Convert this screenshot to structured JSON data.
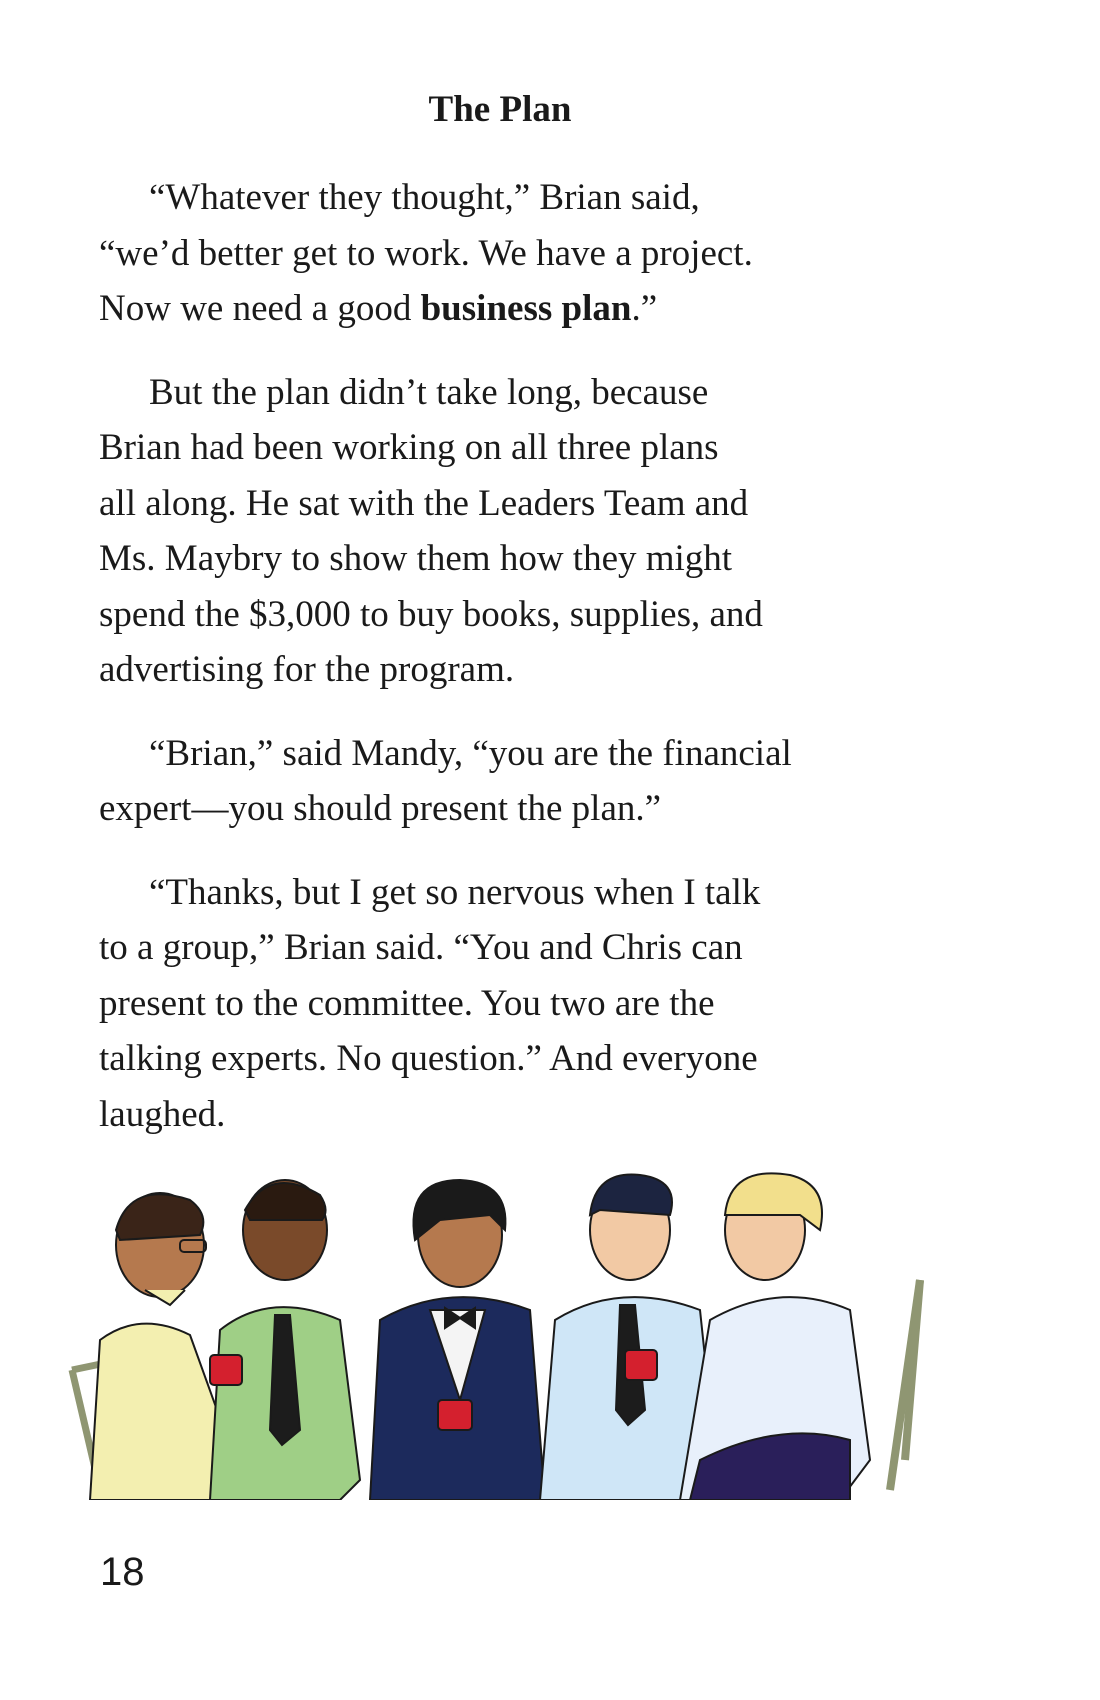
{
  "chapter": {
    "title": "The Plan"
  },
  "paragraphs": [
    {
      "lines": [
        "“Whatever they thought,” Brian said,",
        "“we’d better get to work. We have a project."
      ],
      "line3_pre": "Now we need a good ",
      "line3_bold": "business plan",
      "line3_post": ".”"
    },
    {
      "lines": [
        "But the plan didn’t take long, because",
        "Brian had been working on all three plans",
        "all along. He sat with the Leaders Team and",
        "Ms. Maybry to show them how they might",
        "spend the $3,000 to buy books, supplies, and",
        "advertising for the program."
      ]
    },
    {
      "lines": [
        "“Brian,” said Mandy,  “you are the financial",
        "expert—you should present the plan.”"
      ]
    },
    {
      "lines": [
        "“Thanks, but I get so nervous when I talk",
        "to a group,” Brian said. “You and Chris can",
        "present to the committee. You two are the",
        "talking experts. No question.” And everyone",
        "laughed."
      ]
    }
  ],
  "illustration": {
    "subject": "five-people-seated-with-red-cups",
    "colors": {
      "cup": "#d4202e",
      "skin_dark": "#7a4a2a",
      "skin_light": "#f2c9a4",
      "shirt_yellow": "#f3efb0",
      "shirt_green": "#9fcf86",
      "jacket_navy": "#1c2a5c",
      "shirt_blue": "#cfe6f7",
      "chair": "#8f9672"
    }
  },
  "page": {
    "number": "18"
  }
}
